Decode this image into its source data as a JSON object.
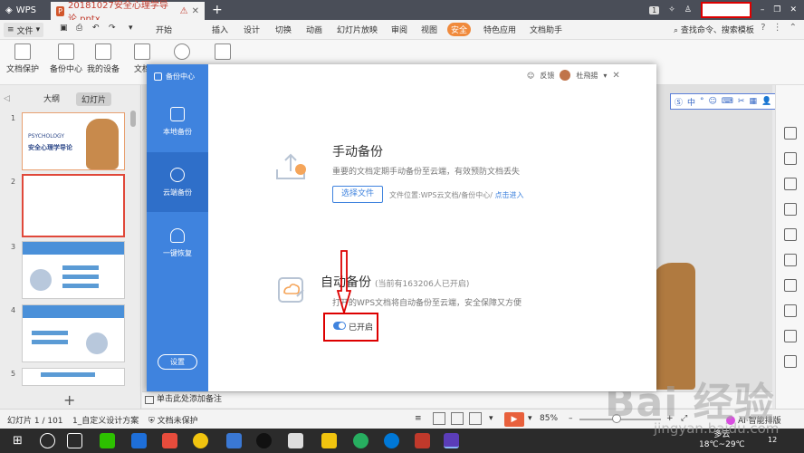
{
  "titlebar": {
    "app_name": "WPS",
    "doc_tab_title": "20181027安全心理学导论.pptx",
    "page_badge": "1"
  },
  "menubar": {
    "file_label": "文件",
    "items": [
      "开始",
      "插入",
      "设计",
      "切换",
      "动画",
      "幻灯片放映",
      "审阅",
      "视图",
      "安全",
      "特色应用",
      "文档助手"
    ],
    "active_item": "安全",
    "search_label": "查找命令、搜索模板"
  },
  "ribbon": {
    "buttons": [
      "文档保护",
      "备份中心",
      "我的设备",
      "文档"
    ]
  },
  "left_panel": {
    "tabs": [
      "大纲",
      "幻灯片"
    ],
    "active_tab": "幻灯片",
    "slide_numbers": [
      "1",
      "2",
      "3",
      "4",
      "5"
    ],
    "slide1_title_en": "PSYCHOLOGY",
    "slide1_title_cn": "安全心理学导论"
  },
  "dialog": {
    "brand": "备份中心",
    "feedback": "反馈",
    "user_name": "杜飛揚",
    "sidebar_items": [
      "本地备份",
      "云端备份",
      "一键恢复"
    ],
    "active_sidebar": "云端备份",
    "settings_label": "设置",
    "manual": {
      "title": "手动备份",
      "desc": "重要的文档定期手动备份至云端，有效预防文档丢失",
      "button": "选择文件",
      "location_text": "文件位置:WPS云文档/备份中心/",
      "location_link": "点击进入"
    },
    "auto": {
      "title": "自动备份",
      "count_text": "(当前有163206人已开启)",
      "desc": "打开的WPS文档将自动备份至云端，安全保障又方便",
      "toggle_label": "已开启",
      "toggle_on": true
    }
  },
  "floatbar": {
    "lang": "中"
  },
  "note": {
    "placeholder": "单击此处添加备注"
  },
  "statusbar": {
    "slide_info": "幻灯片 1 / 101",
    "theme": "1_自定义设计方案",
    "protect": "文档未保护",
    "zoom": "85%",
    "zoom_fraction": 0.45,
    "ai_label": "AI·智能排版"
  },
  "taskbar": {
    "weather": "多云",
    "temp": "18℃~29℃",
    "badge": "12"
  },
  "watermark": {
    "main": "Bai 经验",
    "url": "jingyan.baidu.com"
  },
  "colors": {
    "accent_blue": "#3f83de",
    "highlight_red": "#dd0000",
    "tab_orange": "#f08a3c"
  }
}
